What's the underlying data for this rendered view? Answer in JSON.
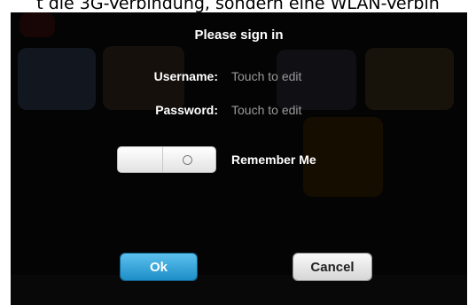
{
  "caption": "t die 3G-Verbindung, sondern eine WLAN-Verbin",
  "dialog": {
    "title": "Please sign in",
    "username_label": "Username:",
    "username_value": "Touch to edit",
    "password_label": "Password:",
    "password_value": "Touch to edit",
    "remember_label": "Remember Me",
    "remember_checked": false,
    "ok_label": "Ok",
    "cancel_label": "Cancel"
  },
  "colors": {
    "accent_button": "#2a9bd6",
    "overlay": "#070707"
  }
}
